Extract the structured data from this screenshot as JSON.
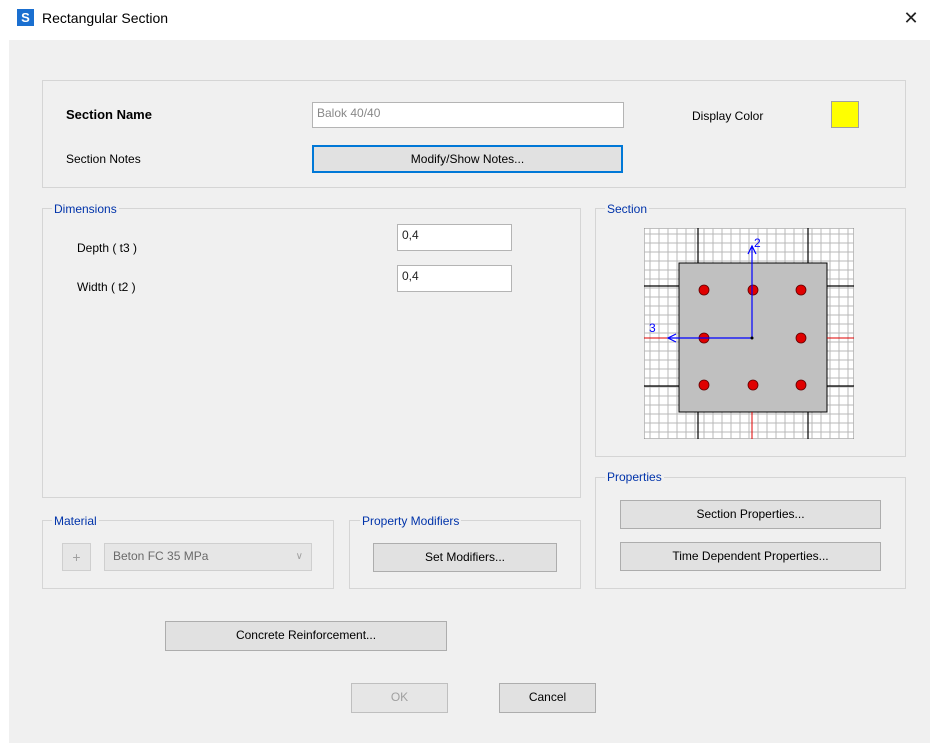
{
  "window": {
    "title": "Rectangular Section",
    "app_icon_letter": "S",
    "close_glyph": "✕"
  },
  "header": {
    "section_name_label": "Section Name",
    "section_name_value": "Balok 40/40",
    "display_color_label": "Display Color",
    "display_color": "#ffff00",
    "section_notes_label": "Section Notes",
    "modify_notes_button": "Modify/Show Notes..."
  },
  "dimensions": {
    "title": "Dimensions",
    "depth_label": "Depth  ( t3 )",
    "depth_value": "0,4",
    "width_label": "Width  ( t2 )",
    "width_value": "0,4"
  },
  "section_preview": {
    "title": "Section",
    "axis2_label": "2",
    "axis3_label": "3",
    "colors": {
      "grid": "#b0b0b0",
      "concrete": "#c0c0c0",
      "rebar": "#e00000",
      "axis": "#0000ff",
      "centerline": "#e00000"
    }
  },
  "properties": {
    "title": "Properties",
    "section_properties_button": "Section Properties...",
    "time_dependent_button": "Time Dependent Properties..."
  },
  "material": {
    "title": "Material",
    "plus_glyph": "+",
    "selected": "Beton FC 35 MPa"
  },
  "property_modifiers": {
    "title": "Property Modifiers",
    "set_modifiers_button": "Set Modifiers..."
  },
  "reinforcement_button": "Concrete Reinforcement...",
  "footer": {
    "ok_button": "OK",
    "cancel_button": "Cancel"
  }
}
